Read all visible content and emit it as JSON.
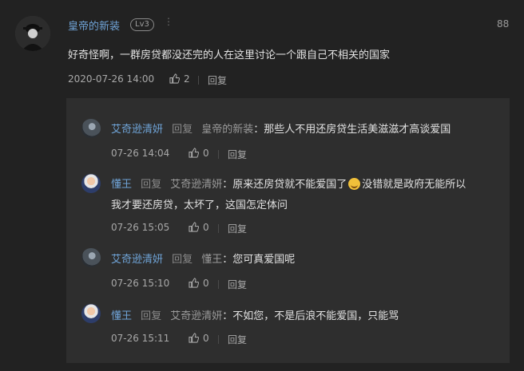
{
  "main_comment": {
    "username": "皇帝的新装",
    "level": "Lv3",
    "more": "⋮",
    "floor": "88",
    "text": "好奇怪啊，一群房贷都没还完的人在这里讨论一个跟自己不相关的国家",
    "time": "2020-07-26 14:00",
    "likes": "2",
    "reply_label": "回复"
  },
  "sub_replies": [
    {
      "username": "艾奇逊清妍",
      "avatar": "anime-avatar",
      "reply_word": "回复",
      "target": "皇帝的新装",
      "text_lines": [
        "：那些人不用还房贷生活美滋滋才高谈爱国"
      ],
      "time": "07-26 14:04",
      "likes": "0",
      "reply_label": "回复"
    },
    {
      "username": "懂王",
      "avatar": "trump-avatar",
      "reply_word": "回复",
      "target": "艾奇逊清妍",
      "text_line1_a": "：原来还房贷就不能爱国了",
      "text_line1_b": "没错就是政府无能所以",
      "text_line2": "我才要还房贷，太坏了，这国怎定体问",
      "time": "07-26 15:05",
      "likes": "0",
      "reply_label": "回复"
    },
    {
      "username": "艾奇逊清妍",
      "avatar": "anime-avatar",
      "reply_word": "回复",
      "target": "懂王",
      "text_lines": [
        "：您可真爱国呢"
      ],
      "time": "07-26 15:10",
      "likes": "0",
      "reply_label": "回复"
    },
    {
      "username": "懂王",
      "avatar": "trump-avatar",
      "reply_word": "回复",
      "target": "艾奇逊清妍",
      "text_lines": [
        "：不如您，不是后浪不能爱国，只能骂"
      ],
      "time": "07-26 15:11",
      "likes": "0",
      "reply_label": "回复"
    }
  ]
}
